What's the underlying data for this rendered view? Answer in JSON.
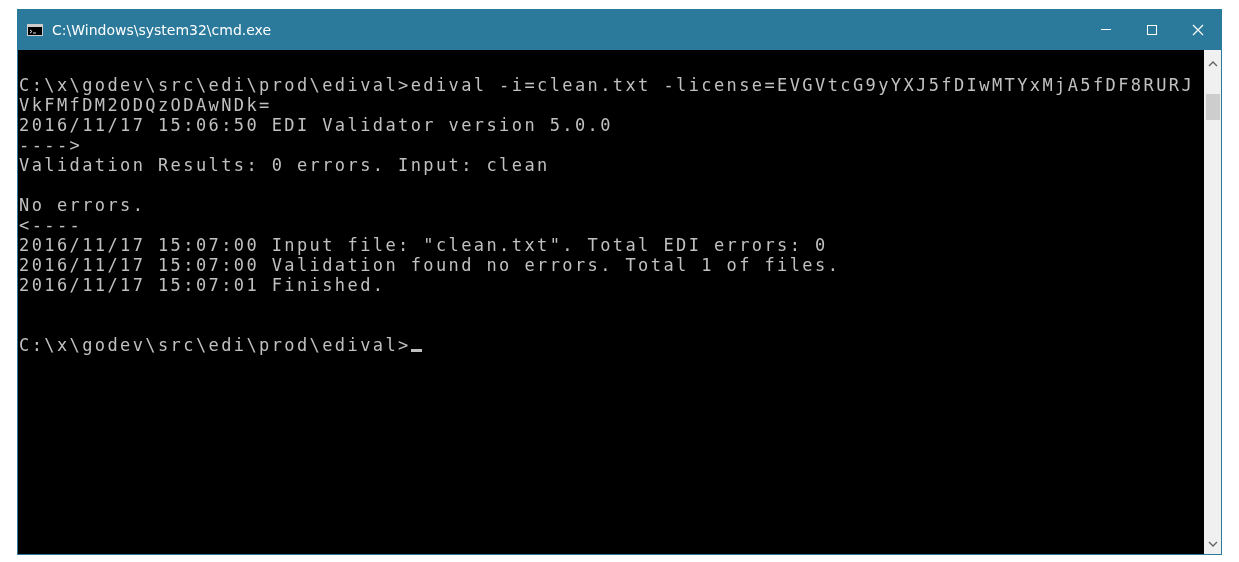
{
  "window": {
    "title": "C:\\Windows\\system32\\cmd.exe"
  },
  "console": {
    "blocks": [
      [
        "C:\\x\\godev\\src\\edi\\prod\\edival>edival -i=clean.txt -license=EVGVtcG9yYXJ5fDIwMTYxMjA5fDF8RURJ",
        "VkFMfDM2ODQzODAwNDk=",
        "2016/11/17 15:06:50 EDI Validator version 5.0.0",
        "---->",
        "Validation Results: 0 errors. Input: clean"
      ],
      [
        "No errors.",
        "<----",
        "2016/11/17 15:07:00 Input file: \"clean.txt\". Total EDI errors: 0",
        "2016/11/17 15:07:00 Validation found no errors. Total 1 of files.",
        "2016/11/17 15:07:01 Finished."
      ]
    ],
    "prompt": "C:\\x\\godev\\src\\edi\\prod\\edival>"
  }
}
